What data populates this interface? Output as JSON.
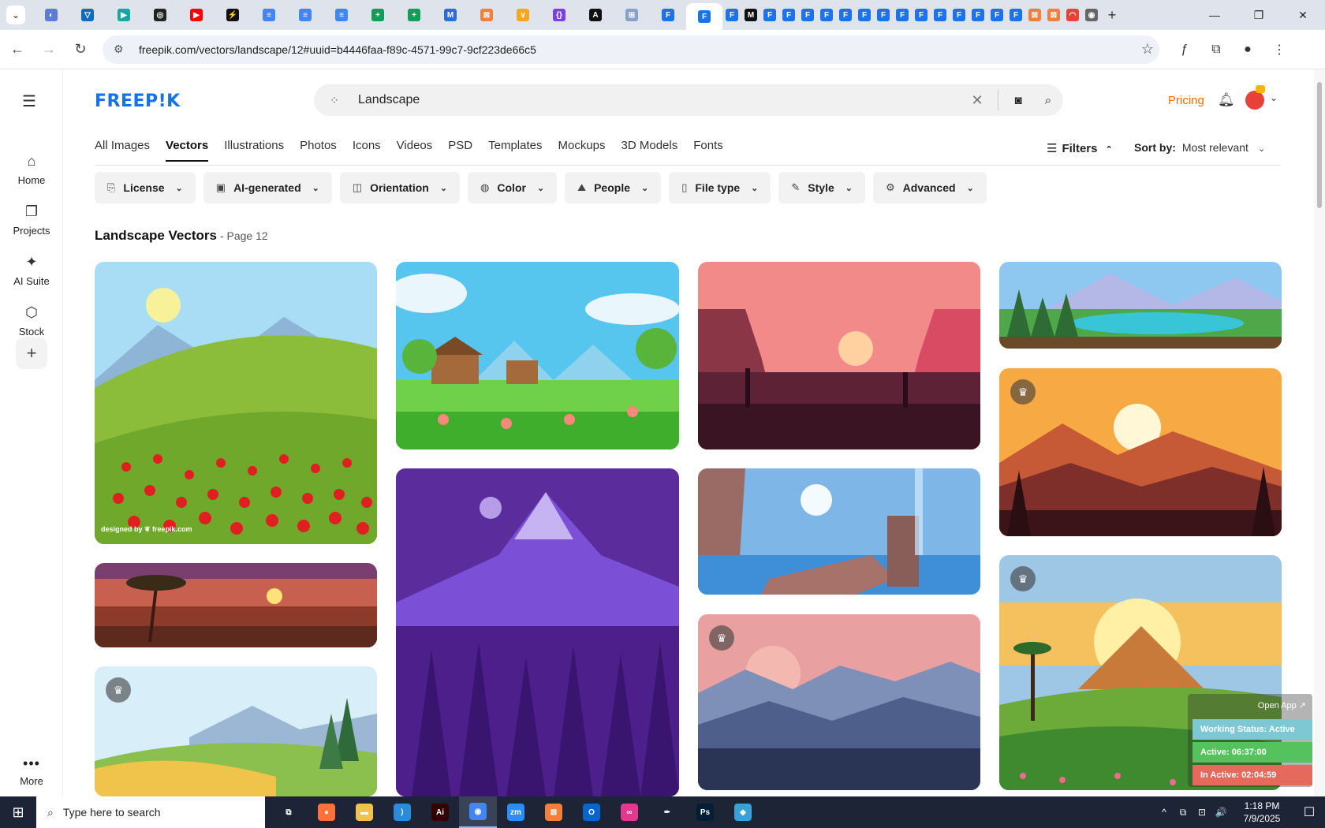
{
  "browser": {
    "tab_favicons": [
      {
        "name": "tab-favicon-1",
        "color": "#5b7bd5",
        "glyph": "◐"
      },
      {
        "name": "tab-favicon-2",
        "color": "#0f6cbd",
        "glyph": "▽"
      },
      {
        "name": "tab-favicon-3",
        "color": "#1aa5a5",
        "glyph": "▶"
      },
      {
        "name": "tab-favicon-4",
        "color": "#222222",
        "glyph": "◎"
      },
      {
        "name": "tab-favicon-youtube",
        "color": "#ff0000",
        "glyph": "▶"
      },
      {
        "name": "tab-favicon-6",
        "color": "#111111",
        "glyph": "⚡"
      },
      {
        "name": "tab-favicon-docs-1",
        "color": "#4285f4",
        "glyph": "≡"
      },
      {
        "name": "tab-favicon-docs-2",
        "color": "#4285f4",
        "glyph": "≡"
      },
      {
        "name": "tab-favicon-docs-3",
        "color": "#4285f4",
        "glyph": "≡"
      },
      {
        "name": "tab-favicon-sheets-1",
        "color": "#0f9d58",
        "glyph": "+"
      },
      {
        "name": "tab-favicon-sheets-2",
        "color": "#0f9d58",
        "glyph": "+"
      },
      {
        "name": "tab-favicon-12",
        "color": "#2b6cd8",
        "glyph": "M"
      },
      {
        "name": "tab-favicon-13",
        "color": "#f0803c",
        "glyph": "⊠"
      },
      {
        "name": "tab-favicon-14",
        "color": "#f5a623",
        "glyph": "∨"
      },
      {
        "name": "tab-favicon-15",
        "color": "#7b3fe4",
        "glyph": "{}"
      },
      {
        "name": "tab-favicon-16",
        "color": "#111111",
        "glyph": "A"
      },
      {
        "name": "tab-favicon-17",
        "color": "#8aa0c8",
        "glyph": "⊞"
      },
      {
        "name": "tab-favicon-forms-1",
        "color": "#1a73e8",
        "glyph": "F"
      }
    ],
    "active_tab_favicon": {
      "color": "#1a73e8",
      "glyph": "F"
    },
    "trailing_favicons": [
      {
        "color": "#1a73e8",
        "glyph": "F"
      },
      {
        "color": "#111111",
        "glyph": "M"
      },
      {
        "color": "#1a73e8",
        "glyph": "F"
      },
      {
        "color": "#1a73e8",
        "glyph": "F"
      },
      {
        "color": "#1a73e8",
        "glyph": "F"
      },
      {
        "color": "#1a73e8",
        "glyph": "F"
      },
      {
        "color": "#1a73e8",
        "glyph": "F"
      },
      {
        "color": "#1a73e8",
        "glyph": "F"
      },
      {
        "color": "#1a73e8",
        "glyph": "F"
      },
      {
        "color": "#1a73e8",
        "glyph": "F"
      },
      {
        "color": "#1a73e8",
        "glyph": "F"
      },
      {
        "color": "#1a73e8",
        "glyph": "F"
      },
      {
        "color": "#1a73e8",
        "glyph": "F"
      },
      {
        "color": "#1a73e8",
        "glyph": "F"
      },
      {
        "color": "#1a73e8",
        "glyph": "F"
      },
      {
        "color": "#1a73e8",
        "glyph": "F"
      },
      {
        "color": "#f0803c",
        "glyph": "⊠"
      },
      {
        "color": "#f0803c",
        "glyph": "⊠"
      },
      {
        "color": "#e8413a",
        "glyph": "◠"
      },
      {
        "color": "#666666",
        "glyph": "◉"
      }
    ],
    "new_tab_label": "+",
    "url": "freepik.com/vectors/landscape/12#uuid=b4446faa-f89c-4571-99c7-9cf223de66c5"
  },
  "rail": {
    "items": [
      {
        "label": "Home",
        "icon": "⌂"
      },
      {
        "label": "Projects",
        "icon": "❐"
      },
      {
        "label": "AI Suite",
        "icon": "✦"
      },
      {
        "label": "Stock",
        "icon": "⬡"
      }
    ],
    "add_label": "+",
    "more_label": "More",
    "more_icon": "•••"
  },
  "header": {
    "logo": "FREEP!K",
    "search_value": "Landscape",
    "pricing": "Pricing"
  },
  "categories": [
    "All Images",
    "Vectors",
    "Illustrations",
    "Photos",
    "Icons",
    "Videos",
    "PSD",
    "Templates",
    "Mockups",
    "3D Models",
    "Fonts"
  ],
  "active_category": "Vectors",
  "filters_label": "Filters",
  "sort": {
    "label": "Sort by:",
    "value": "Most relevant"
  },
  "chips": [
    {
      "label": "License",
      "icon": "⎘"
    },
    {
      "label": "AI-generated",
      "icon": "▣"
    },
    {
      "label": "Orientation",
      "icon": "◫"
    },
    {
      "label": "Color",
      "icon": "◍"
    },
    {
      "label": "People",
      "icon": "⛰"
    },
    {
      "label": "File type",
      "icon": "▯"
    },
    {
      "label": "Style",
      "icon": "✎"
    },
    {
      "label": "Advanced",
      "icon": "⚙"
    }
  ],
  "results": {
    "title": "Landscape Vectors",
    "page": "- Page 12"
  },
  "credit": "designed by ❦ freepik.com",
  "widget": {
    "open_app": "Open App ↗",
    "status": "Working Status: Active",
    "active": "Active: 06:37:00",
    "inactive": "In Active: 02:04:59"
  },
  "taskbar": {
    "search_placeholder": "Type here to search",
    "apps": [
      {
        "name": "task-view",
        "color": "#1c2436",
        "glyph": "⧉"
      },
      {
        "name": "firefox",
        "color": "#ff7139",
        "glyph": "●"
      },
      {
        "name": "file-explorer",
        "color": "#f2c14e",
        "glyph": "▬"
      },
      {
        "name": "vscode",
        "color": "#2a8bd8",
        "glyph": "⟩"
      },
      {
        "name": "illustrator",
        "color": "#330000",
        "glyph": "Ai"
      },
      {
        "name": "chrome",
        "color": "#4285f4",
        "glyph": "◉"
      },
      {
        "name": "zoom",
        "color": "#2d8cff",
        "glyph": "zm"
      },
      {
        "name": "xampp",
        "color": "#f0803c",
        "glyph": "⊠"
      },
      {
        "name": "outlook",
        "color": "#0a64c9",
        "glyph": "O"
      },
      {
        "name": "creative-cloud",
        "color": "#e2388d",
        "glyph": "∞"
      },
      {
        "name": "pen-tool",
        "color": "#1c2436",
        "glyph": "✒"
      },
      {
        "name": "photoshop",
        "color": "#001e36",
        "glyph": "Ps"
      },
      {
        "name": "app-diamond",
        "color": "#3aa0d8",
        "glyph": "◆"
      }
    ],
    "tray_icons": [
      "^",
      "⧉",
      "⊡",
      "🔊"
    ],
    "time": "1:18 PM",
    "date": "7/9/2025",
    "notification_icon": "☐"
  }
}
